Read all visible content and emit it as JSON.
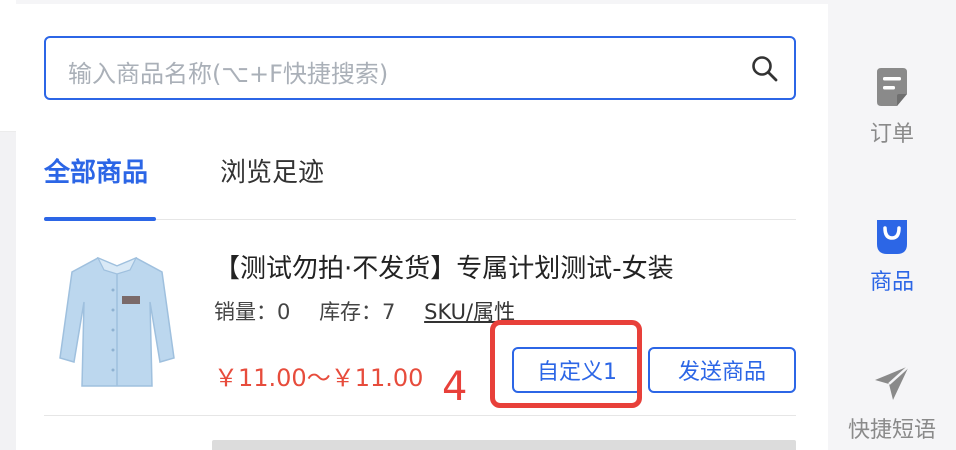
{
  "search": {
    "placeholder": "输入商品名称(⌥+F快捷搜索)"
  },
  "tabs": [
    {
      "label": "全部商品",
      "active": true
    },
    {
      "label": "浏览足迹",
      "active": false
    }
  ],
  "product": {
    "title": "【测试勿拍·不发货】专属计划测试-女装",
    "sales_label": "销量：0",
    "stock_label": "库存：7",
    "sku_link": "SKU/属性",
    "price": "￥11.00～￥11.00",
    "custom_button": "自定义1",
    "send_button": "发送商品"
  },
  "annotation": {
    "number": "4",
    "color": "#e8403a"
  },
  "sidebar": {
    "items": [
      {
        "label": "订单",
        "icon": "order-icon",
        "active": false
      },
      {
        "label": "商品",
        "icon": "bag-icon",
        "active": true
      },
      {
        "label": "快捷短语",
        "icon": "send-icon",
        "active": false
      }
    ]
  },
  "colors": {
    "accent": "#2c66e6",
    "price": "#e74c3c",
    "inactive_icon": "#8a8a8a"
  }
}
